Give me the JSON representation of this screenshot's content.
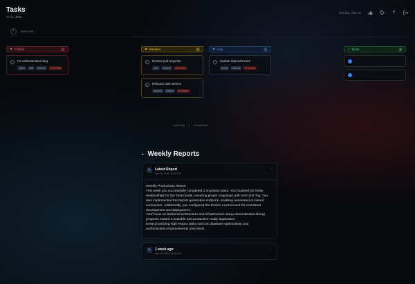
{
  "header": {
    "title": "Tasks",
    "hello_prefix": "Hello,",
    "user": "John",
    "date": "Monday, Mar 10"
  },
  "new_task": {
    "placeholder": "New task..."
  },
  "columns": [
    {
      "name": "Critical",
      "count": "1",
      "color": "#f87171",
      "cards": [
        {
          "title": "Fix authentication bug",
          "tags": [
            "urgent",
            "auth",
            "backend",
            "1d overdue"
          ]
        }
      ]
    },
    {
      "name": "Medium",
      "count": "2",
      "color": "#facc15",
      "cards": [
        {
          "title": "Review pull requests",
          "tags": [
            "code",
            "backend",
            "2d overdue"
          ]
        },
        {
          "title": "Refactor task service",
          "tags": [
            "backend",
            "refactor",
            "3d overdue"
          ]
        }
      ]
    },
    {
      "name": "Low",
      "count": "1",
      "color": "#60a5fa",
      "cards": [
        {
          "title": "Update dependencies",
          "tags": [
            "tooling",
            "backend",
            "4d overdue"
          ]
        }
      ]
    },
    {
      "name": "Done",
      "count": "2",
      "color": "#4ade80"
    }
  ],
  "stats": {
    "pending": "4 pending",
    "completed": "2 completed"
  },
  "reports": {
    "title": "Weekly Reports",
    "latest": {
      "name": "Latest Report",
      "date": "Mar 10, 2025, 02:30 PM",
      "lines": [
        "Weekly Productivity Report",
        "This week you successfully completed 3 important tasks. You finalized the entity",
        "relationships for the Task model, ensuring proper mappings with User and Tag. You",
        "also implemented the Report generation endpoint, enabling automated AI-based",
        "summaries. Additionally, you configured the Docker environment for consistent",
        "development and deployment.",
        "Your focus on backend architecture and infrastructure setup demonstrates strong",
        "progress toward a scalable and production-ready application.",
        "Keep prioritizing high-impact tasks such as database optimization and",
        "authentication improvements next week."
      ]
    },
    "older": {
      "name": "1 week ago",
      "date": "Mar 03, 2025, 09:40 PM"
    }
  }
}
